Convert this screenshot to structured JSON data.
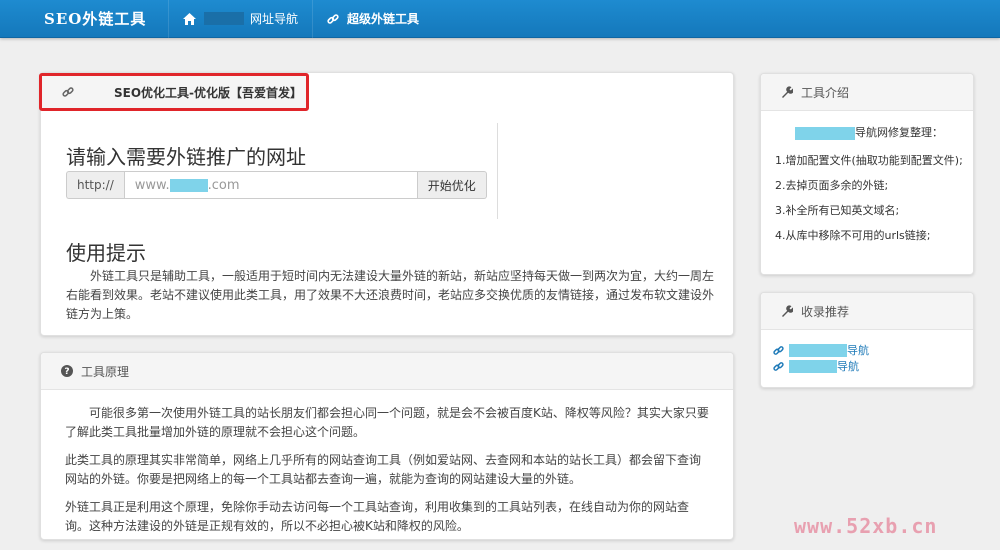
{
  "navbar": {
    "brand": "SEO外链工具",
    "items": [
      {
        "icon": "home-icon",
        "label": "网址导航"
      },
      {
        "icon": "link-icon",
        "label": "超级外链工具"
      }
    ]
  },
  "main": {
    "header_title": "SEO优化工具-优化版【吾爱首发】",
    "enter_heading": "请输入需要外链推广的网址",
    "url_prefix": "http://",
    "url_value_start": "www.",
    "url_value_end": ".com",
    "submit_label": "开始优化",
    "tips_heading": "使用提示",
    "tips_text": "外链工具只是辅助工具，一般适用于短时间内无法建设大量外链的新站，新站应坚持每天做一到两次为宜，大约一周左右能看到效果。老站不建议使用此类工具，用了效果不大还浪费时间，老站应多交换优质的友情链接，通过发布软文建设外链方为上策。"
  },
  "principle": {
    "header_title": "工具原理",
    "paragraphs": [
      "可能很多第一次使用外链工具的站长朋友们都会担心同一个问题，就是会不会被百度K站、降权等风险？其实大家只要了解此类工具批量增加外链的原理就不会担心这个问题。",
      "此类工具的原理其实非常简单，网络上几乎所有的网站查询工具（例如爱站网、去查网和本站的站长工具）都会留下查询网站的外链。你要是把网络上的每一个工具站都去查询一遍，就能为查询的网站建设大量的外链。",
      "外链工具正是利用这个原理，免除你手动去访问每一个工具站查询，利用收集到的工具站列表，在线自动为你的网站查询。这种方法建设的外链是正规有效的，所以不必担心被K站和降权的风险。"
    ]
  },
  "intro": {
    "header_title": "工具介绍",
    "title_suffix": "导航网修复整理：",
    "items": [
      "1.增加配置文件(抽取功能到配置文件);",
      "2.去掉页面多余的外链;",
      "3.补全所有已知英文域名;",
      "4.从库中移除不可用的urls链接;"
    ]
  },
  "recommend": {
    "header_title": "收录推荐",
    "items": [
      "导航",
      "导航"
    ]
  },
  "watermark": "www.52xb.cn",
  "colors": {
    "navbar": "#1478bb",
    "highlight_border": "#e0252a",
    "link": "#1e7ab8",
    "redaction": "#7fd3ea"
  }
}
